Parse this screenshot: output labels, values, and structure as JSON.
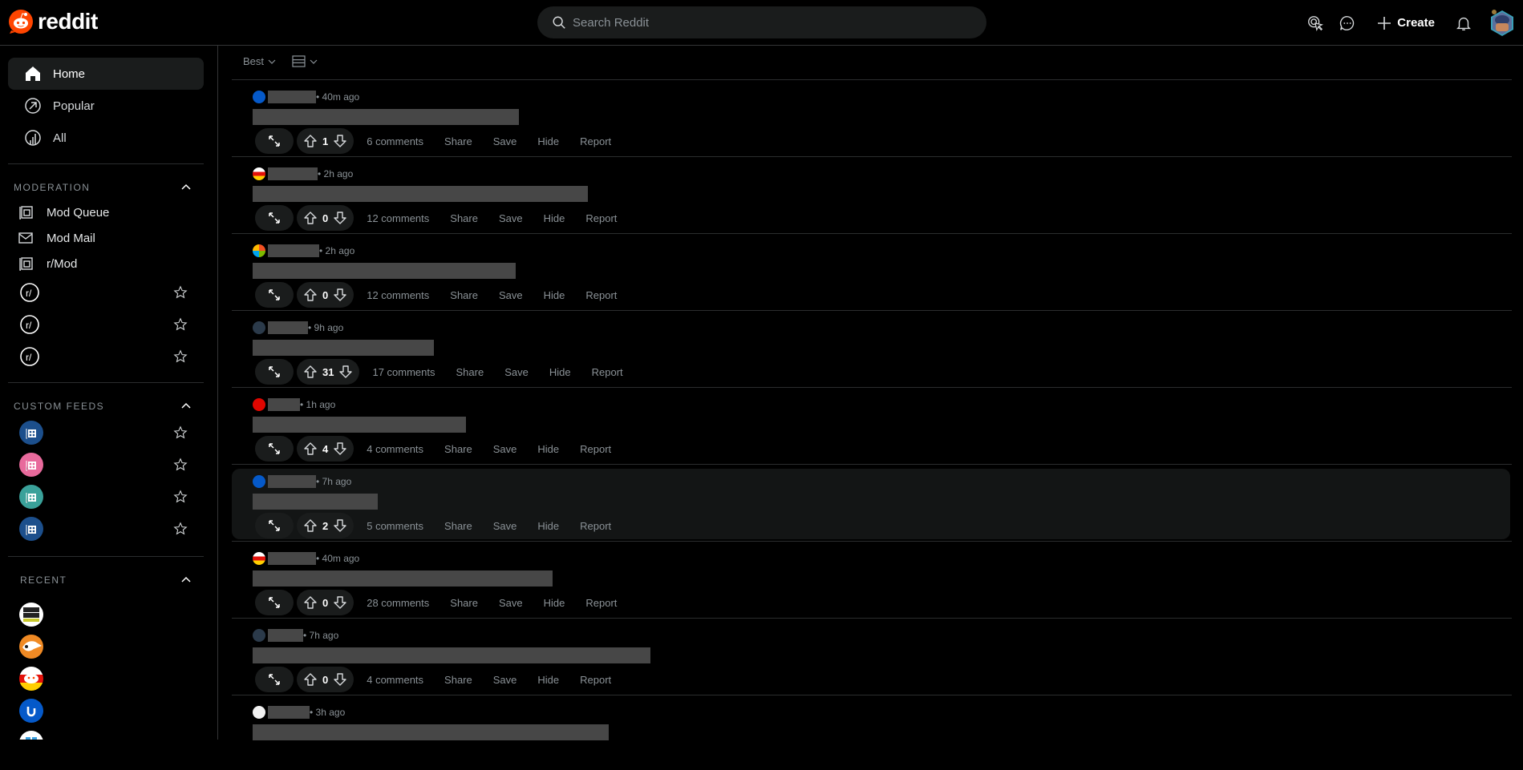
{
  "header": {
    "logo_text": "reddit",
    "search_placeholder": "Search Reddit",
    "create_label": "Create",
    "icons": [
      "advertise-icon",
      "chat-icon",
      "plus-icon",
      "bell-icon",
      "user-avatar"
    ]
  },
  "sidebar": {
    "nav": [
      {
        "label": "Home",
        "icon": "home-icon",
        "active": true
      },
      {
        "label": "Popular",
        "icon": "popular-icon",
        "active": false
      },
      {
        "label": "All",
        "icon": "all-icon",
        "active": false
      }
    ],
    "moderation": {
      "title": "MODERATION",
      "items": [
        {
          "label": "Mod Queue",
          "icon": "mod-queue-icon"
        },
        {
          "label": "Mod Mail",
          "icon": "mod-mail-icon"
        },
        {
          "label": "r/Mod",
          "icon": "mod-icon"
        }
      ],
      "communities": [
        {
          "icon": "subreddit-icon"
        },
        {
          "icon": "subreddit-icon"
        },
        {
          "icon": "subreddit-icon"
        }
      ]
    },
    "custom_feeds": {
      "title": "CUSTOM FEEDS",
      "feeds": [
        {
          "color": "#1c4f8c"
        },
        {
          "color": "#e86a9c"
        },
        {
          "color": "#3aa19a"
        },
        {
          "color": "#1c4f8c"
        }
      ]
    },
    "recent": {
      "title": "RECENT",
      "items": [
        {
          "icon": "super-mario-run-icon"
        },
        {
          "icon": "orange-bird-icon"
        },
        {
          "icon": "snoo-germany-icon"
        },
        {
          "icon": "ubiquiti-icon"
        },
        {
          "icon": "windows-icon"
        }
      ]
    }
  },
  "feed": {
    "sort_label": "Best",
    "view_icon": "card-view-icon",
    "action_labels": {
      "share": "Share",
      "save": "Save",
      "hide": "Hide",
      "report": "Report"
    },
    "posts": [
      {
        "avatar": "ubiquiti",
        "time": "• 40m ago",
        "votes": "1",
        "comments": "6 comments",
        "highlighted": false
      },
      {
        "avatar": "snoo-germany",
        "time": "• 2h ago",
        "votes": "0",
        "comments": "12 comments",
        "highlighted": false
      },
      {
        "avatar": "microsoft",
        "time": "• 2h ago",
        "votes": "0",
        "comments": "12 comments",
        "highlighted": false
      },
      {
        "avatar": "pirate",
        "time": "• 9h ago",
        "votes": "31",
        "comments": "17 comments",
        "highlighted": false
      },
      {
        "avatar": "f1",
        "time": "• 1h ago",
        "votes": "4",
        "comments": "4 comments",
        "highlighted": false
      },
      {
        "avatar": "ubiquiti",
        "time": "• 7h ago",
        "votes": "2",
        "comments": "5 comments",
        "highlighted": true
      },
      {
        "avatar": "snoo-germany",
        "time": "• 40m ago",
        "votes": "0",
        "comments": "28 comments",
        "highlighted": false
      },
      {
        "avatar": "pirate",
        "time": "• 7h ago",
        "votes": "0",
        "comments": "4 comments",
        "highlighted": false
      },
      {
        "avatar": "snoo-white",
        "time": "• 3h ago",
        "votes": "",
        "comments": "",
        "highlighted": false
      }
    ]
  },
  "colors": {
    "brand": "#ff4500",
    "background": "#000000",
    "surface": "#1a1c1c",
    "muted_text": "#8a9196"
  }
}
